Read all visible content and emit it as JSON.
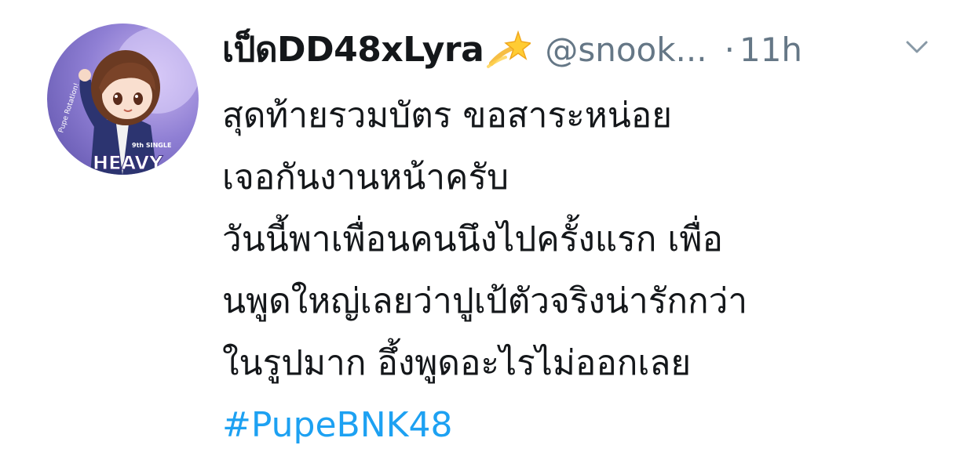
{
  "tweet": {
    "display_name": "เป็ดDD48xLyra",
    "display_name_emoji": "dizzy-emoji",
    "handle": "@snook...",
    "separator": "·",
    "time": "11h",
    "menu_icon": "chevron-down-icon",
    "lines": [
      "สุดท้ายรวมบัตร ขอสาระหน่อย",
      "เจอกันงานหน้าครับ",
      "วันนี้พาเพื่อนคนนึงไปครั้งแรก เพื่อ",
      "นพูดใหญ่เลยว่าปูเป้ตัวจริงน่ารักกว่า",
      "ในรูปมาก อึ้งพูดอะไรไม่ออกเลย"
    ],
    "hashtag": "#PupeBNK48",
    "avatar_text": {
      "side": "Pupe Rotation!",
      "small": "9th SINGLE",
      "big": "HEAVY"
    }
  },
  "colors": {
    "text": "#14171a",
    "muted": "#657786",
    "link": "#1da1f2",
    "background": "#ffffff"
  }
}
